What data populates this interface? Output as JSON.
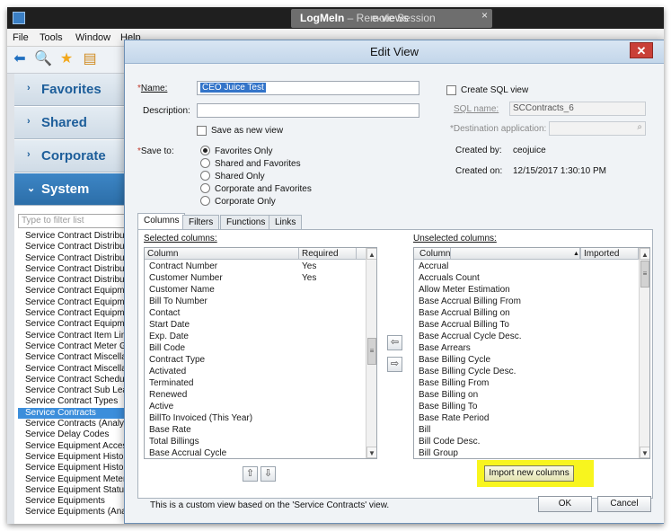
{
  "app": {
    "logmein_title": "LogMeIn",
    "logmein_sub": " – Remote Session",
    "overlay_title": "e-views",
    "close_glyph": "×"
  },
  "menu": [
    "File",
    "Tools",
    "Window",
    "Help"
  ],
  "nav": {
    "sections": [
      "Favorites",
      "Shared",
      "Corporate",
      "System"
    ],
    "active_section": "System",
    "filter_placeholder": "Type to filter list",
    "items": [
      "Service Contract Distribution",
      "Service Contract Distribution",
      "Service Contract Distribution",
      "Service Contract Distribution",
      "Service Contract Distribution",
      "Service Contract Equipment",
      "Service Contract Equipment",
      "Service Contract Equipment",
      "Service Contract Equipment",
      "Service Contract Item Lines",
      "Service Contract Meter Groups",
      "Service Contract Miscellaneous",
      "Service Contract Miscellaneous",
      "Service Contract Schedules",
      "Service Contract Sub Leases",
      "Service Contract Types",
      "Service Contracts",
      "Service Contracts (Analysis)",
      "Service Delay Codes",
      "Service Equipment Accessories",
      "Service Equipment History",
      "Service Equipment History",
      "Service Equipment Meters",
      "Service Equipment Status",
      "Service Equipments",
      "Service Equipments (Analysis)"
    ],
    "selected_item_index": 16
  },
  "dialog": {
    "title": "Edit View",
    "name_label": "Name:",
    "name_value": "CEO Juice Test",
    "description_label": "Description:",
    "description_value": "",
    "save_as_new_label": "Save as new view",
    "save_to_label": "Save to:",
    "save_to_options": [
      "Favorites Only",
      "Shared and Favorites",
      "Shared Only",
      "Corporate and Favorites",
      "Corporate Only"
    ],
    "save_to_selected": "Favorites Only",
    "create_sql_label": "Create SQL view",
    "sql_name_label": "SQL name:",
    "sql_name_value": "SCContracts_6",
    "dest_app_label": "*Destination application:",
    "created_by_label": "Created by:",
    "created_by_value": "ceojuice",
    "created_on_label": "Created on:",
    "created_on_value": "12/15/2017 1:30:10 PM",
    "tabs": [
      "Columns",
      "Filters",
      "Functions",
      "Links"
    ],
    "active_tab": "Columns",
    "selected_columns_label": "Selected columns:",
    "unselected_columns_label": "Unselected columns:",
    "selected_headers": [
      "Column",
      "Required"
    ],
    "unselected_headers": [
      "Column",
      "Imported"
    ],
    "selected_rows": [
      {
        "column": "Contract Number",
        "required": "Yes"
      },
      {
        "column": "Customer Number",
        "required": "Yes"
      },
      {
        "column": "Customer Name",
        "required": ""
      },
      {
        "column": "Bill To Number",
        "required": ""
      },
      {
        "column": "Contact",
        "required": ""
      },
      {
        "column": "Start Date",
        "required": ""
      },
      {
        "column": "Exp. Date",
        "required": ""
      },
      {
        "column": "Bill Code",
        "required": ""
      },
      {
        "column": "Contract Type",
        "required": ""
      },
      {
        "column": "Activated",
        "required": ""
      },
      {
        "column": "Terminated",
        "required": ""
      },
      {
        "column": "Renewed",
        "required": ""
      },
      {
        "column": "Active",
        "required": ""
      },
      {
        "column": "BillTo Invoiced (This Year)",
        "required": ""
      },
      {
        "column": "Base Rate",
        "required": ""
      },
      {
        "column": "Total Billings",
        "required": ""
      },
      {
        "column": "Base Accrual Cycle",
        "required": ""
      }
    ],
    "unselected_rows": [
      "Accrual",
      "Accruals Count",
      "Allow Meter Estimation",
      "Base Accrual Billing From",
      "Base Accrual Billing on",
      "Base Accrual Billing To",
      "Base Accrual Cycle Desc.",
      "Base Arrears",
      "Base Billing Cycle",
      "Base Billing Cycle Desc.",
      "Base Billing From",
      "Base Billing on",
      "Base Billing To",
      "Base Rate Period",
      "Bill",
      "Bill Code Desc.",
      "Bill Group"
    ],
    "import_button": "Import new columns",
    "footer_note": "This is a custom view based on the 'Service Contracts' view.",
    "ok_label": "OK",
    "cancel_label": "Cancel"
  },
  "colors": {
    "nav_text": "#1d5e9a",
    "nav_active_bg": "#2c6ea8",
    "selected_item_bg": "#3c8edb",
    "highlight": "#f8f51e",
    "close_button": "#c94038"
  }
}
